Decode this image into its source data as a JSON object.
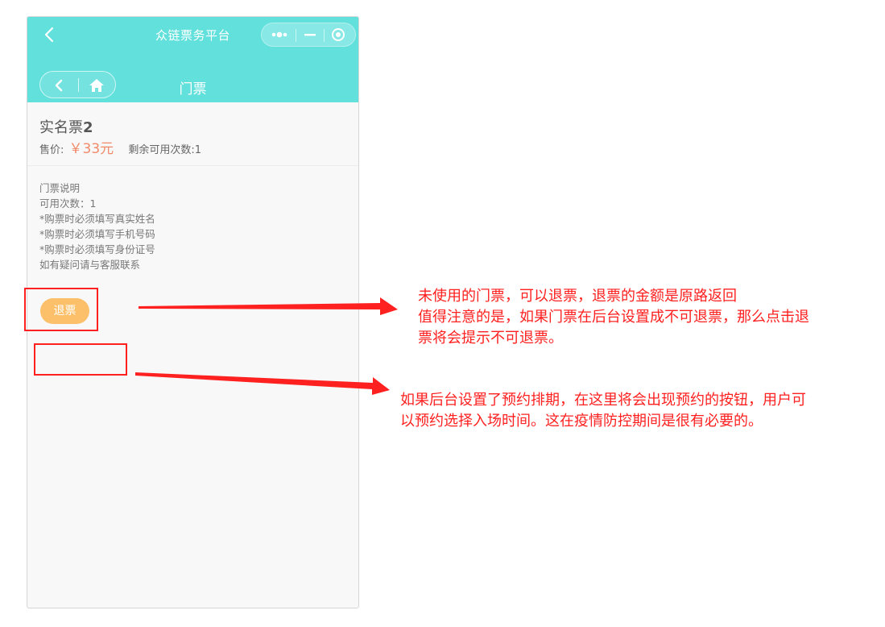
{
  "app": {
    "title": "众链票务平台",
    "page_title": "门票",
    "theme_color": "#61e0dc"
  },
  "ticket": {
    "name_text": "实名票",
    "name_number": "2",
    "price_label": "售价:",
    "price_value": "￥33元",
    "remaining": "剩余可用次数:1"
  },
  "description": {
    "lines": [
      "门票说明",
      "可用次数：1",
      "*购票时必须填写真实姓名",
      "*购票时必须填写手机号码",
      "*购票时必须填写身份证号",
      "如有疑问请与客服联系"
    ]
  },
  "actions": {
    "refund_label": "退票",
    "refund_color": "#fdc06a"
  },
  "annotations": {
    "note1_lines": [
      "未使用的门票，可以退票，退票的金额是原路返回",
      "值得注意的是，如果门票在后台设置成不可退票，那么点击退",
      "票将会提示不可退票。"
    ],
    "note2_lines": [
      "如果后台设置了预约排期，在这里将会出现预约的按钮，用户可",
      "以预约选择入场时间。这在疫情防控期间是很有必要的。"
    ],
    "color": "#ff2020"
  },
  "icons": [
    "back-arrow-icon",
    "more-dots-icon",
    "minimize-icon",
    "close-target-icon",
    "home-icon"
  ]
}
